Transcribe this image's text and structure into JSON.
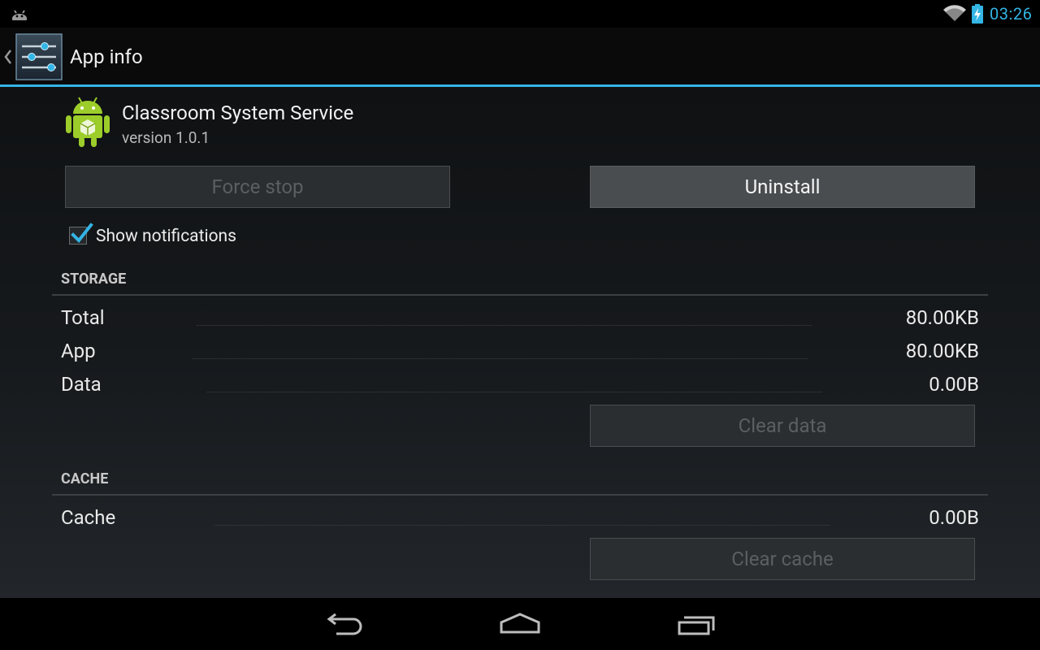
{
  "status_bar": {
    "time": "03:26",
    "icons": [
      "android-debug-icon",
      "wifi-icon",
      "battery-charging-icon"
    ],
    "accent_color": "#33b5e5"
  },
  "action_bar": {
    "title": "App info",
    "icons": [
      "up-caret-icon",
      "settings-sliders-icon"
    ]
  },
  "app": {
    "name": "Classroom System Service",
    "version": "version 1.0.1",
    "icon": "android-icon"
  },
  "buttons": {
    "force_stop": "Force stop",
    "uninstall": "Uninstall",
    "clear_data": "Clear data",
    "clear_cache": "Clear cache"
  },
  "notifications": {
    "label": "Show notifications",
    "checked": true
  },
  "storage": {
    "header": "STORAGE",
    "rows": [
      {
        "label": "Total",
        "value": "80.00KB"
      },
      {
        "label": "App",
        "value": "80.00KB"
      },
      {
        "label": "Data",
        "value": "0.00B"
      }
    ]
  },
  "cache": {
    "header": "CACHE",
    "rows": [
      {
        "label": "Cache",
        "value": "0.00B"
      }
    ]
  },
  "nav_bar": {
    "icons": [
      "back-icon",
      "home-icon",
      "recent-apps-icon"
    ]
  }
}
